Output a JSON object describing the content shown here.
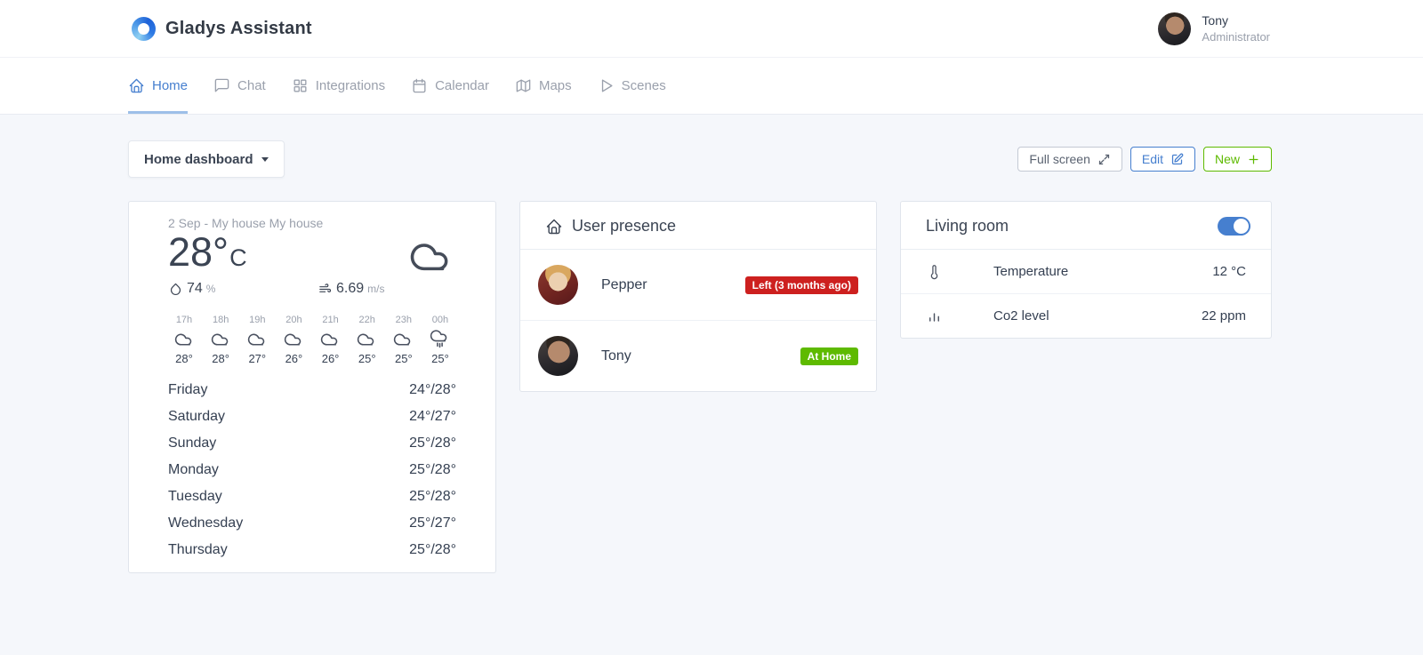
{
  "app": {
    "title": "Gladys Assistant"
  },
  "header": {
    "user_name": "Tony",
    "user_role": "Administrator"
  },
  "nav": {
    "home": "Home",
    "chat": "Chat",
    "integrations": "Integrations",
    "calendar": "Calendar",
    "maps": "Maps",
    "scenes": "Scenes",
    "active_tab": "Home"
  },
  "toolbar": {
    "dashboard_selector": "Home dashboard",
    "full_screen": "Full screen",
    "edit": "Edit",
    "new": "New"
  },
  "weather": {
    "header": "2 Sep - My house My house",
    "temperature": "28°",
    "temperature_unit": "C",
    "condition_icon": "cloud",
    "humidity": "74",
    "humidity_unit": "%",
    "wind_speed": "6.69",
    "wind_unit": "m/s",
    "hourly": [
      {
        "hour": "17h",
        "icon": "cloud",
        "temp": "28°"
      },
      {
        "hour": "18h",
        "icon": "cloud",
        "temp": "28°"
      },
      {
        "hour": "19h",
        "icon": "cloud",
        "temp": "27°"
      },
      {
        "hour": "20h",
        "icon": "cloud",
        "temp": "26°"
      },
      {
        "hour": "21h",
        "icon": "cloud",
        "temp": "26°"
      },
      {
        "hour": "22h",
        "icon": "cloud",
        "temp": "25°"
      },
      {
        "hour": "23h",
        "icon": "cloud",
        "temp": "25°"
      },
      {
        "hour": "00h",
        "icon": "cloud-rain",
        "temp": "25°"
      }
    ],
    "daily": [
      {
        "day": "Friday",
        "temps": "24°/28°"
      },
      {
        "day": "Saturday",
        "temps": "24°/27°"
      },
      {
        "day": "Sunday",
        "temps": "25°/28°"
      },
      {
        "day": "Monday",
        "temps": "25°/28°"
      },
      {
        "day": "Tuesday",
        "temps": "25°/28°"
      },
      {
        "day": "Wednesday",
        "temps": "25°/27°"
      },
      {
        "day": "Thursday",
        "temps": "25°/28°"
      }
    ]
  },
  "presence": {
    "title": "User presence",
    "users": [
      {
        "name": "Pepper",
        "status": "Left (3 months ago)",
        "status_color": "#cd201f"
      },
      {
        "name": "Tony",
        "status": "At Home",
        "status_color": "#5eba00"
      }
    ]
  },
  "room": {
    "title": "Living room",
    "power_toggle": "on",
    "devices": [
      {
        "name": "Temperature",
        "value": "12 °C",
        "icon": "thermometer-icon"
      },
      {
        "name": "Co2 level",
        "value": "22 ppm",
        "icon": "bar-chart-icon"
      }
    ]
  },
  "colors": {
    "accent_blue": "#467fcf",
    "success_green": "#5eba00",
    "danger_red": "#cd201f",
    "background": "#f5f7fb",
    "text_dark": "#354052",
    "text_muted": "#9aa0ac"
  }
}
